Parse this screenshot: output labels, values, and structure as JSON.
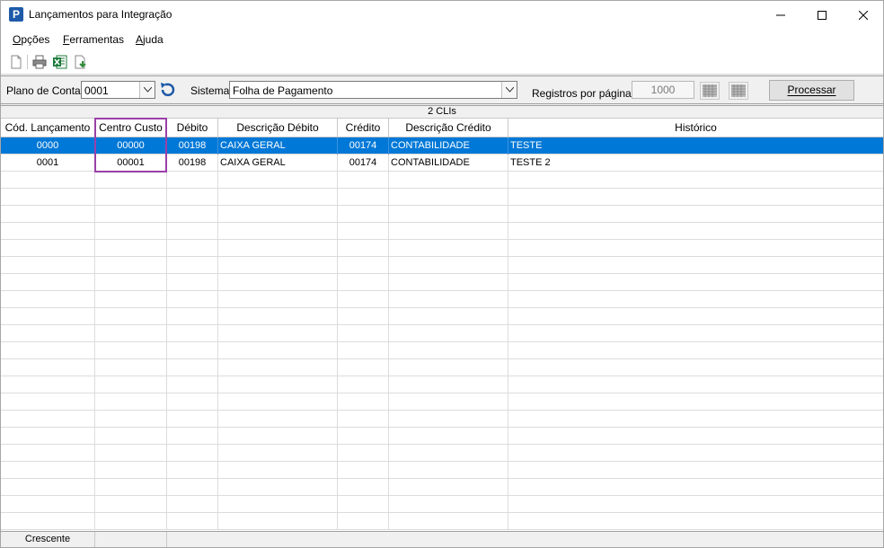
{
  "window": {
    "title": "Lançamentos para Integração",
    "app_icon_letter": "P"
  },
  "menu": {
    "items": [
      {
        "key": "O",
        "rest": "pções"
      },
      {
        "key": "F",
        "rest": "erramentas"
      },
      {
        "key": "A",
        "rest": "juda"
      }
    ]
  },
  "filters": {
    "plano_label": "Plano de Contas",
    "plano_value": "0001",
    "sistema_label": "Sistema",
    "sistema_value": "Folha de Pagamento",
    "registros_label": "Registros por páginas:",
    "registros_value": "1000",
    "process_label": "Processar"
  },
  "grid": {
    "count_label": "2 CLIs",
    "columns": [
      "Cód. Lançamento",
      "Centro Custo",
      "Débito",
      "Descrição Débito",
      "Crédito",
      "Descrição Crédito",
      "Histórico"
    ],
    "rows": [
      [
        "0000",
        "00000",
        "00198",
        "CAIXA GERAL",
        "00174",
        "CONTABILIDADE",
        "TESTE"
      ],
      [
        "0001",
        "00001",
        "00198",
        "CAIXA GERAL",
        "00174",
        "CONTABILIDADE",
        "TESTE 2"
      ]
    ],
    "selected_row": 0,
    "selected_color": "#0078d7",
    "highlight_color": "#9b3fa8"
  },
  "footer": {
    "sort_label": "Crescente"
  }
}
